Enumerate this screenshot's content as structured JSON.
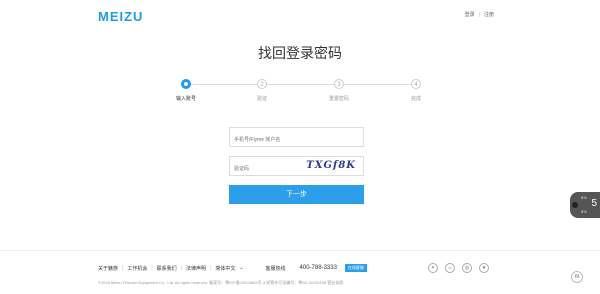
{
  "header": {
    "logo": "MEIZU",
    "login": "登录",
    "register": "注册"
  },
  "page_title": "找回登录密码",
  "steps": [
    {
      "num": "",
      "label": "输入账号"
    },
    {
      "num": "2",
      "label": "验证"
    },
    {
      "num": "3",
      "label": "重置密码"
    },
    {
      "num": "4",
      "label": "完成"
    }
  ],
  "form": {
    "account_placeholder": "手机号/Flyme 账户名",
    "captcha_placeholder": "验证码",
    "captcha_text": "TXGf8K",
    "next_label": "下一步"
  },
  "side_widget": {
    "number": "5",
    "label_top": "8%",
    "label_bottom": "8%"
  },
  "footer": {
    "links": [
      "关于魅族",
      "工作机会",
      "联系我们",
      "法律声明",
      "简体中文"
    ],
    "hotline_label": "客服热线",
    "phone": "400-788-3333",
    "online_service": "在线客服",
    "copyright": "©2016 Meizu Telecom Equipment Co., Ltd. All rights reserved. 备案号：粤ICP备13003602号-4  经营许可证编号：粤B2-20130198  营业执照"
  },
  "social_icons": [
    "weibo-icon",
    "wechat-icon",
    "qq-icon",
    "star-icon"
  ]
}
